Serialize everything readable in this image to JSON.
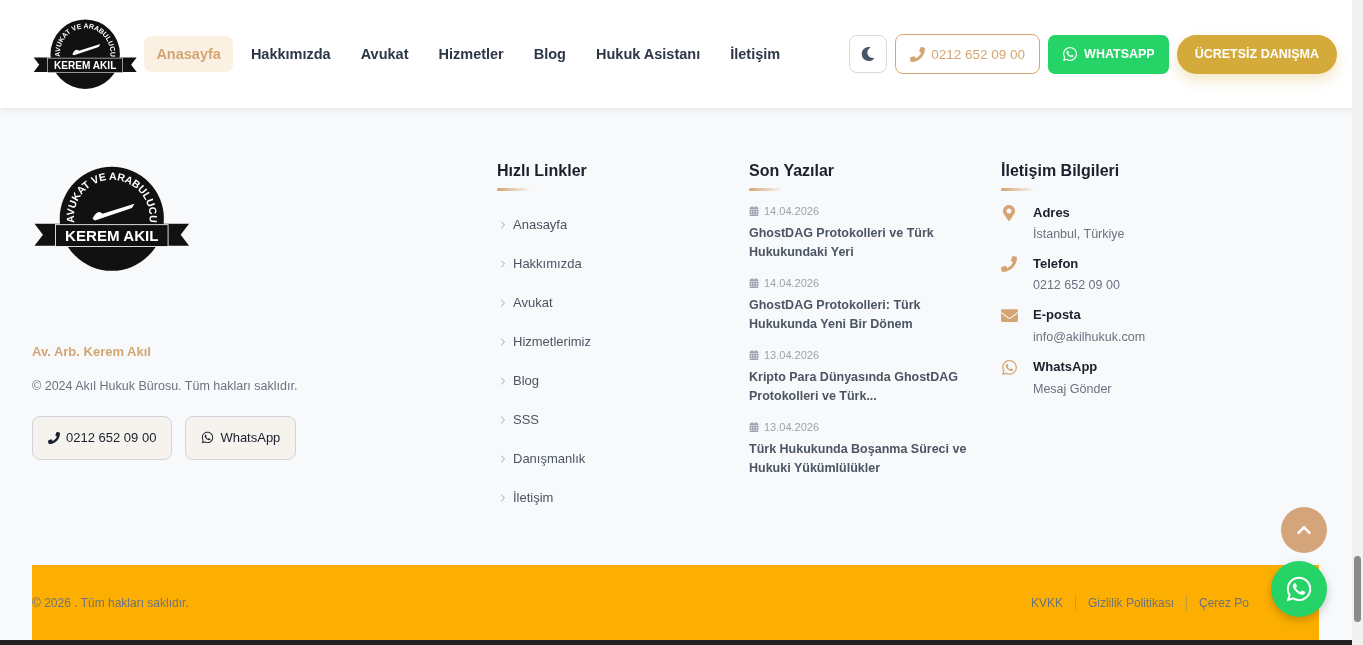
{
  "logo": {
    "arc_text": "AVUKAT VE ARABULUCU",
    "ribbon_text": "KEREM AKIL"
  },
  "footer_logo": {
    "arc_text": "AVUKAT VE ARABULUCU",
    "ribbon_text": "KEREM AKIL"
  },
  "nav": [
    {
      "label": "Anasayfa",
      "selected": true
    },
    {
      "label": "Hakkımızda",
      "selected": false
    },
    {
      "label": "Avukat",
      "selected": false
    },
    {
      "label": "Hizmetler",
      "selected": false
    },
    {
      "label": "Blog",
      "selected": false
    },
    {
      "label": "Hukuk Asistanı",
      "selected": false
    },
    {
      "label": "İletişim",
      "selected": false
    }
  ],
  "header_actions": {
    "phone": "0212 652 09 00",
    "whatsapp": "WHATSAPP",
    "consult": "ÜCRETSİZ DANIŞMA"
  },
  "about": {
    "name": "Av. Arb. Kerem Akıl",
    "copyright": "© 2024 Akıl Hukuk Bürosu. Tüm hakları saklıdır.",
    "phone": "0212 652 09 00",
    "whatsapp": "WhatsApp"
  },
  "quick_links": {
    "title": "Hızlı Linkler",
    "items": [
      "Anasayfa",
      "Hakkımızda",
      "Avukat",
      "Hizmetlerimiz",
      "Blog",
      "SSS",
      "Danışmanlık",
      "İletişim"
    ]
  },
  "recent_posts": {
    "title": "Son Yazılar",
    "items": [
      {
        "date": "14.04.2026",
        "title": "GhostDAG Protokolleri ve Türk Hukukundaki Yeri"
      },
      {
        "date": "14.04.2026",
        "title": "GhostDAG Protokolleri: Türk Hukukunda Yeni Bir Dönem"
      },
      {
        "date": "13.04.2026",
        "title": "Kripto Para Dünyasında GhostDAG Protokolleri ve Türk..."
      },
      {
        "date": "13.04.2026",
        "title": "Türk Hukukunda Boşanma Süreci ve Hukuki Yükümlülükler"
      }
    ]
  },
  "contact": {
    "title": "İletişim Bilgileri",
    "items": [
      {
        "kind": "address",
        "label": "Adres",
        "value": "İstanbul, Türkiye"
      },
      {
        "kind": "phone",
        "label": "Telefon",
        "value": "0212 652 09 00"
      },
      {
        "kind": "email",
        "label": "E-posta",
        "value": "info@akilhukuk.com"
      },
      {
        "kind": "whatsapp",
        "label": "WhatsApp",
        "value": "Mesaj Gönder"
      }
    ]
  },
  "bottom_bar": {
    "copyright": "© 2026 . Tüm hakları saklıdır.",
    "links": [
      "KVKK",
      "Gizlilik Politikası",
      "Çerez Po"
    ]
  }
}
